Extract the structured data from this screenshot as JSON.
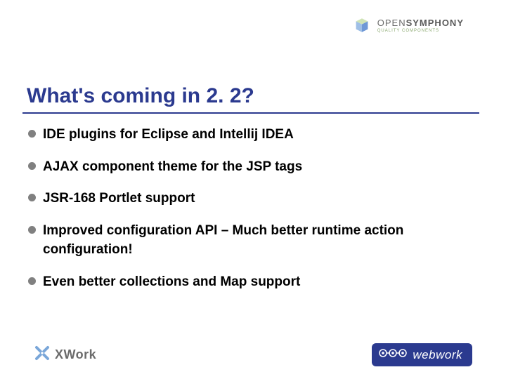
{
  "header": {
    "brand_main_light": "OPEN",
    "brand_main_bold": "SYMPHONY",
    "brand_sub": "QUALITY COMPONENTS"
  },
  "title": "What's coming in 2. 2?",
  "bullets": [
    "IDE plugins for Eclipse and Intellij IDEA",
    "AJAX component theme for the JSP tags",
    "JSR-168 Portlet support",
    "Improved configuration API – Much better runtime action configuration!",
    "Even better collections and Map support"
  ],
  "footer": {
    "left_brand": "XWork",
    "right_brand": "webwork"
  },
  "colors": {
    "title": "#2b3a8f",
    "rule": "#2b3a8f",
    "bullet_dot": "#808080",
    "webwork_bg": "#2b3a8f"
  }
}
